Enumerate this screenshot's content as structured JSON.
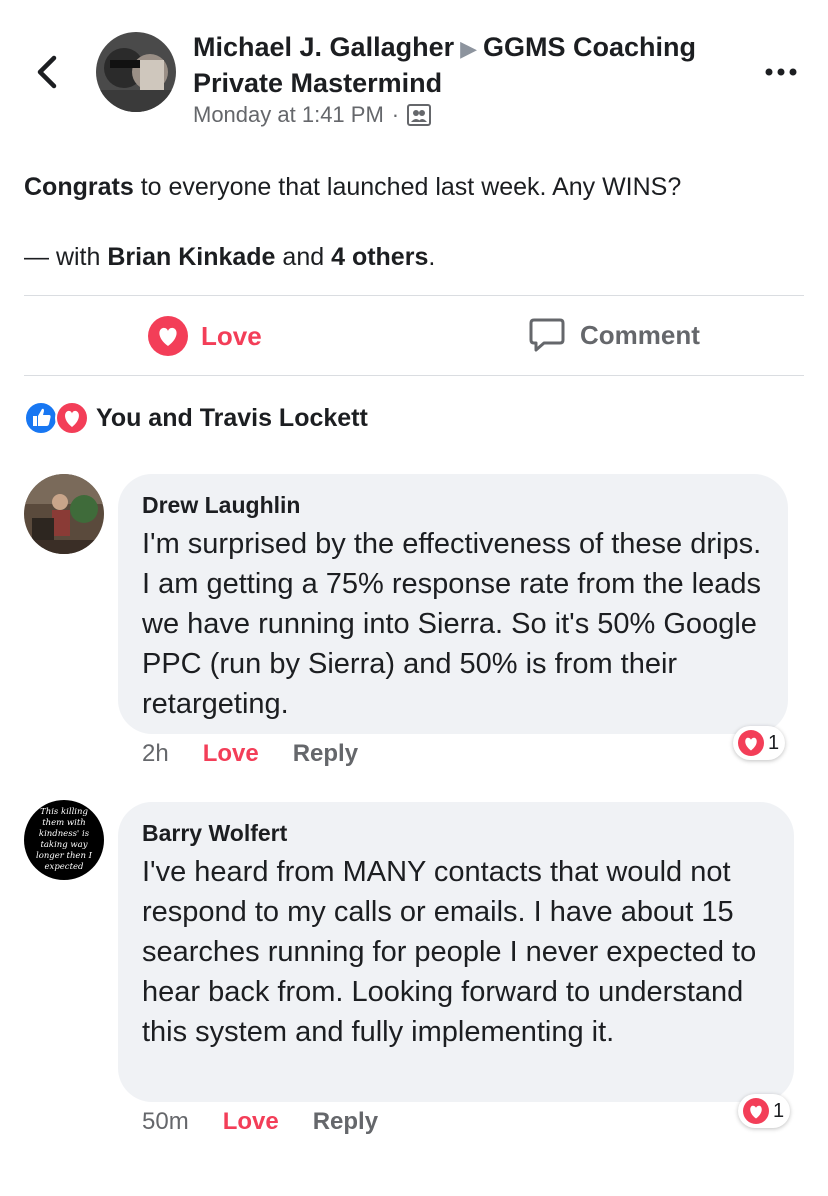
{
  "header": {
    "author": "Michael J. Gallagher",
    "group": "GGMS Coaching Private Mastermind",
    "timestamp": "Monday at 1:41 PM",
    "audience_icon": "group-audience-icon",
    "back_icon": "chevron-left-icon",
    "more_icon": "more-dots-icon"
  },
  "post": {
    "bold_word": "Congrats",
    "text_rest": "to everyone that launched last week. Any WINS?",
    "with_prefix": "— with",
    "tagged_name": "Brian Kinkade",
    "and_word": "and",
    "others": "4 others",
    "period": "."
  },
  "actions": {
    "love_label": "Love",
    "comment_label": "Comment"
  },
  "reactions": {
    "summary": "You and Travis Lockett",
    "icons": [
      "like-icon",
      "love-icon"
    ]
  },
  "comments": [
    {
      "name": "Drew Laughlin",
      "text": "I'm surprised by the effectiveness of these drips. I am getting a 75% response rate from the leads we have running into Sierra. So it's 50% Google PPC (run by Sierra) and 50% is from their retargeting.",
      "time": "2h",
      "love_label": "Love",
      "reply_label": "Reply",
      "reaction_count": "1"
    },
    {
      "name": "Barry Wolfert",
      "avatar_text": "This killing them with kindness' is taking way longer then I expected",
      "text": "I've heard from MANY contacts that would not respond to my calls or emails.  I have about 15 searches running for people I never expected to hear back from.  Looking forward to understand this system and fully implementing it.",
      "time": "50m",
      "love_label": "Love",
      "reply_label": "Reply",
      "reaction_count": "1"
    }
  ],
  "colors": {
    "love": "#f33e58",
    "like": "#1877f2",
    "muted": "#65676b",
    "bubble": "#f0f2f5"
  }
}
